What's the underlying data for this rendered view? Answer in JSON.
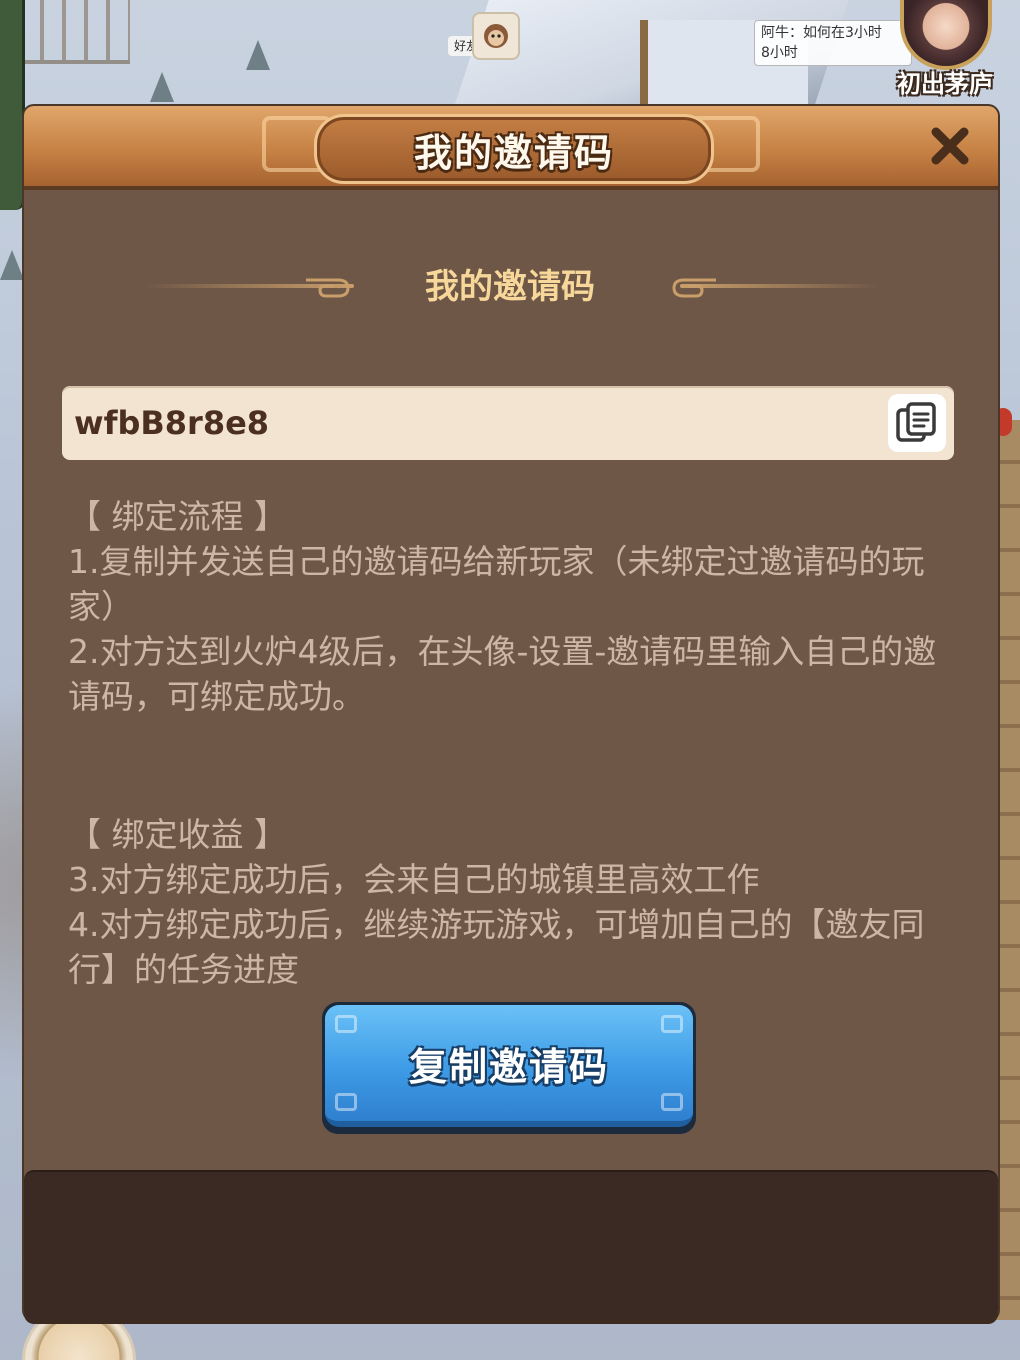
{
  "background": {
    "npc_chip": "好友",
    "chat_bubble": "阿牛：如何在3小时\n8小时",
    "player_title": "初出茅庐"
  },
  "dialog": {
    "title": "我的邀请码",
    "subtitle": "我的邀请码",
    "invite_code": "wfbB8r8e8",
    "bind_process_header": "【 绑定流程 】",
    "bind_process_steps": [
      "1.复制并发送自己的邀请码给新玩家（未绑定过邀请码的玩家）",
      "2.对方达到火炉4级后，在头像-设置-邀请码里输入自己的邀请码，可绑定成功。"
    ],
    "bind_benefit_header": "【 绑定收益 】",
    "bind_benefit_steps": [
      "3.对方绑定成功后，会来自己的城镇里高效工作",
      "4.对方绑定成功后，继续游玩游戏，可增加自己的【邀友同行】的任务进度"
    ],
    "copy_button_label": "复制邀请码",
    "icons": {
      "close": "close-icon",
      "copy": "copy-icon"
    }
  },
  "colors": {
    "panel": "#6e5747",
    "header": "#c78245",
    "text_muted": "#cdb6a3",
    "subtitle_gold": "#f7d89a",
    "button_blue": "#3e9be6"
  }
}
